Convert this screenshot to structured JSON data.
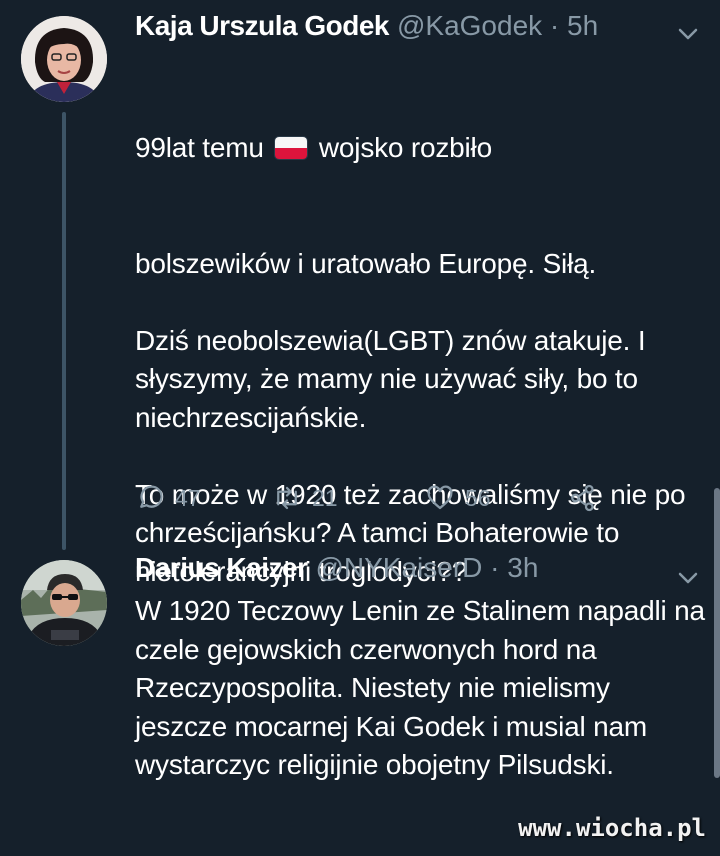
{
  "tweets": [
    {
      "name": "Kaja Urszula Godek",
      "handle_time": "@KaGodek · 5h",
      "line1_pre": "99lat temu ",
      "line1_post": " wojsko rozbiło",
      "text": "bolszewików i uratowało Europę. Siłą.\n\nDziś neobolszewia(LGBT) znów atakuje. I słyszymy, że mamy nie używać siły, bo to niechrzescijańskie.\n\nTo może w 1920 też zachowaliśmy się nie po chrześcijańsku? A tamci Bohaterowie to nietolerancyjni troglodyci??",
      "replies": "47",
      "retweets": "21",
      "likes": "56",
      "avatar_icon": "profile-photo-woman",
      "flag_icon": "poland-flag-emoji"
    },
    {
      "name": "Darius Kaizer",
      "handle_time": "@NYKaiserD · 3h",
      "text": "W 1920 Teczowy Lenin ze Stalinem napadli na czele gejowskich czerwonych hord na Rzeczypospolita. Niestety nie mielismy jeszcze mocarnej Kai Godek i musial nam wystarczyc religijnie obojetny Pilsudski.",
      "avatar_icon": "profile-photo-man"
    }
  ],
  "watermark": "www.wiocha.pl",
  "colors": {
    "background": "#15202b",
    "secondary_text": "#8899a6",
    "thread_line": "#3d5466"
  }
}
